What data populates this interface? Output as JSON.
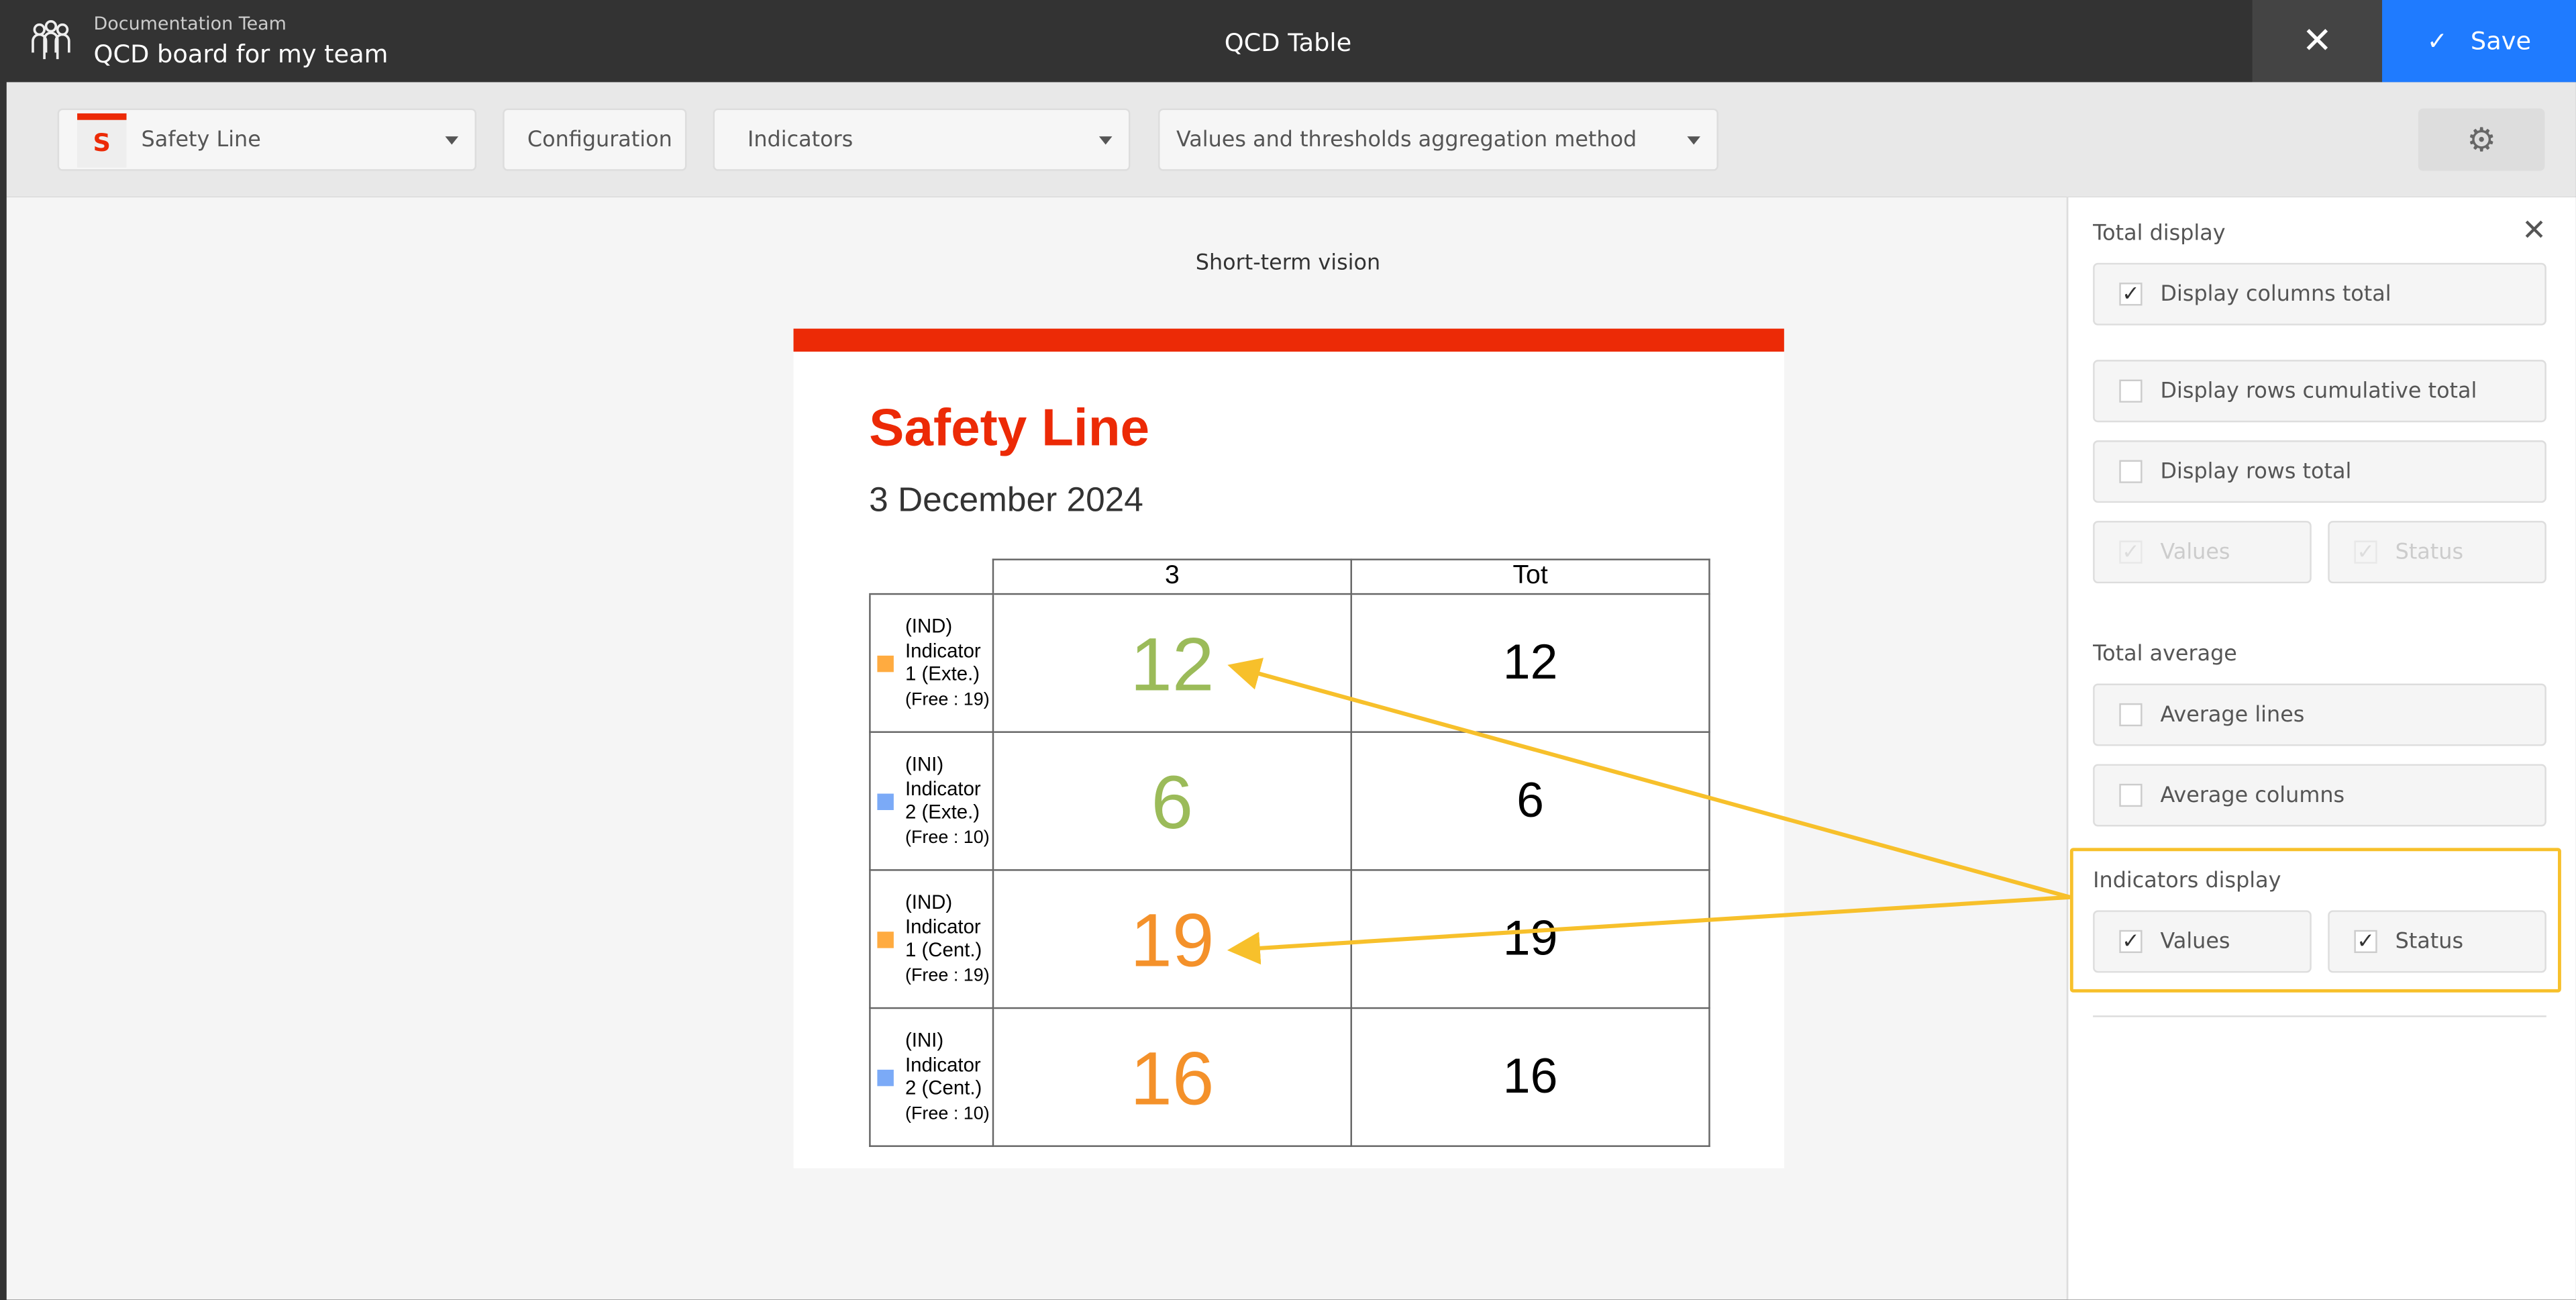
{
  "header": {
    "subtitle": "Documentation Team",
    "title": "QCD board for my team",
    "center_title": "QCD Table",
    "save_label": "Save",
    "close_icon": "close-icon",
    "save_icon": "check-icon"
  },
  "toolbar": {
    "board_select": "Safety Line",
    "configuration": "Configuration",
    "indicators": "Indicators",
    "aggregation": "Values and thresholds aggregation method",
    "settings_icon": "gear-icon"
  },
  "main": {
    "vision": "Short-term vision",
    "card": {
      "title": "Safety Line",
      "date": "3 December 2024",
      "accent": "#ec2a06",
      "columns": [
        "3",
        "Tot"
      ],
      "rows": [
        {
          "code": "(IND)",
          "name": "Indicator 1 (Exte.)",
          "free": "(Free : 19)",
          "color": "#ffab40",
          "value": "12",
          "value_color": "#9bbb59",
          "total": "12"
        },
        {
          "code": "(INI)",
          "name": "Indicator 2 (Exte.)",
          "free": "(Free : 10)",
          "color": "#7baaf7",
          "value": "6",
          "value_color": "#9bbb59",
          "total": "6"
        },
        {
          "code": "(IND)",
          "name": "Indicator 1 (Cent.)",
          "free": "(Free : 19)",
          "color": "#ffab40",
          "value": "19",
          "value_color": "#f4912a",
          "total": "19"
        },
        {
          "code": "(INI)",
          "name": "Indicator 2 (Cent.)",
          "free": "(Free : 10)",
          "color": "#7baaf7",
          "value": "16",
          "value_color": "#f4912a",
          "total": "16"
        }
      ]
    }
  },
  "panel": {
    "total_display": "Total display",
    "display_columns_total": {
      "label": "Display columns total",
      "checked": true
    },
    "display_rows_cumulative": {
      "label": "Display rows cumulative total",
      "checked": false
    },
    "display_rows_total": {
      "label": "Display rows total",
      "checked": false
    },
    "total_values": {
      "label": "Values",
      "checked": true,
      "disabled": true
    },
    "total_status": {
      "label": "Status",
      "checked": true,
      "disabled": true
    },
    "total_average": "Total average",
    "average_lines": {
      "label": "Average lines",
      "checked": false
    },
    "average_columns": {
      "label": "Average columns",
      "checked": false
    },
    "indicators_display": "Indicators display",
    "ind_values": {
      "label": "Values",
      "checked": true
    },
    "ind_status": {
      "label": "Status",
      "checked": true
    }
  },
  "annotation_color": "#f7c02b"
}
